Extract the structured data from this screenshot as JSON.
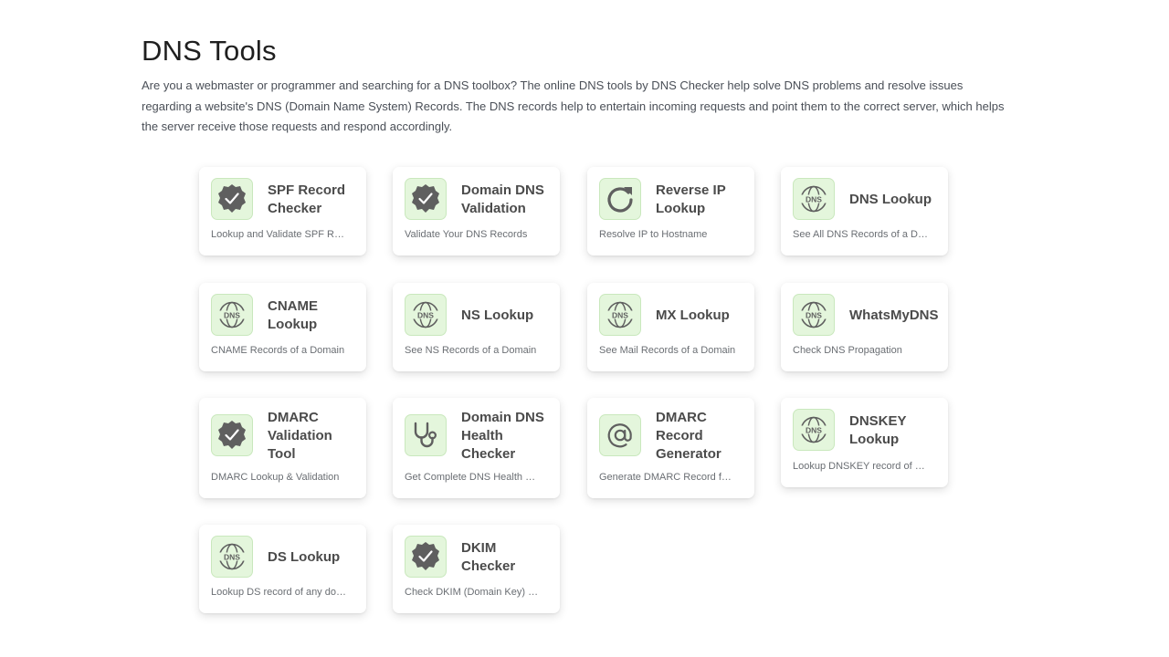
{
  "page": {
    "title": "DNS Tools",
    "intro": "Are you a webmaster or programmer and searching for a DNS toolbox? The online DNS tools by DNS Checker help solve DNS problems and resolve issues regarding a website's DNS (Domain Name System) Records. The DNS records help to entertain incoming requests and point them to the correct server, which helps the server receive those requests and respond accordingly."
  },
  "colors": {
    "icon_bg": "#e4f6dc",
    "icon_border": "#c9e8bd",
    "icon_fg": "#5f5f5f"
  },
  "tools": [
    {
      "title": "SPF Record Checker",
      "desc": "Lookup and Validate SPF Records",
      "icon": "verified-badge-icon"
    },
    {
      "title": "Domain DNS Validation",
      "desc": "Validate Your DNS Records",
      "icon": "verified-badge-icon"
    },
    {
      "title": "Reverse IP Lookup",
      "desc": "Resolve IP to Hostname",
      "icon": "refresh-icon"
    },
    {
      "title": "DNS Lookup",
      "desc": "See All DNS Records of a Domain",
      "icon": "dns-globe-icon"
    },
    {
      "title": "CNAME Lookup",
      "desc": "CNAME Records of a Domain",
      "icon": "dns-globe-icon"
    },
    {
      "title": "NS Lookup",
      "desc": "See NS Records of a Domain",
      "icon": "dns-globe-icon"
    },
    {
      "title": "MX Lookup",
      "desc": "See Mail Records of a Domain",
      "icon": "dns-globe-icon"
    },
    {
      "title": "WhatsMyDNS",
      "desc": "Check DNS Propagation",
      "icon": "dns-globe-icon"
    },
    {
      "title": "DMARC Validation Tool",
      "desc": "DMARC Lookup & Validation",
      "icon": "verified-badge-icon"
    },
    {
      "title": "Domain DNS Health Checker",
      "desc": "Get Complete DNS Health Report",
      "icon": "stethoscope-icon"
    },
    {
      "title": "DMARC Record Generator",
      "desc": "Generate DMARC Record for Domain",
      "icon": "at-sign-icon"
    },
    {
      "title": "DNSKEY Lookup",
      "desc": "Lookup DNSKEY record of any domain",
      "icon": "dns-globe-icon"
    },
    {
      "title": "DS Lookup",
      "desc": "Lookup DS record of any domain",
      "icon": "dns-globe-icon"
    },
    {
      "title": "DKIM Checker",
      "desc": "Check DKIM (Domain Key) Record",
      "icon": "verified-badge-icon"
    }
  ]
}
